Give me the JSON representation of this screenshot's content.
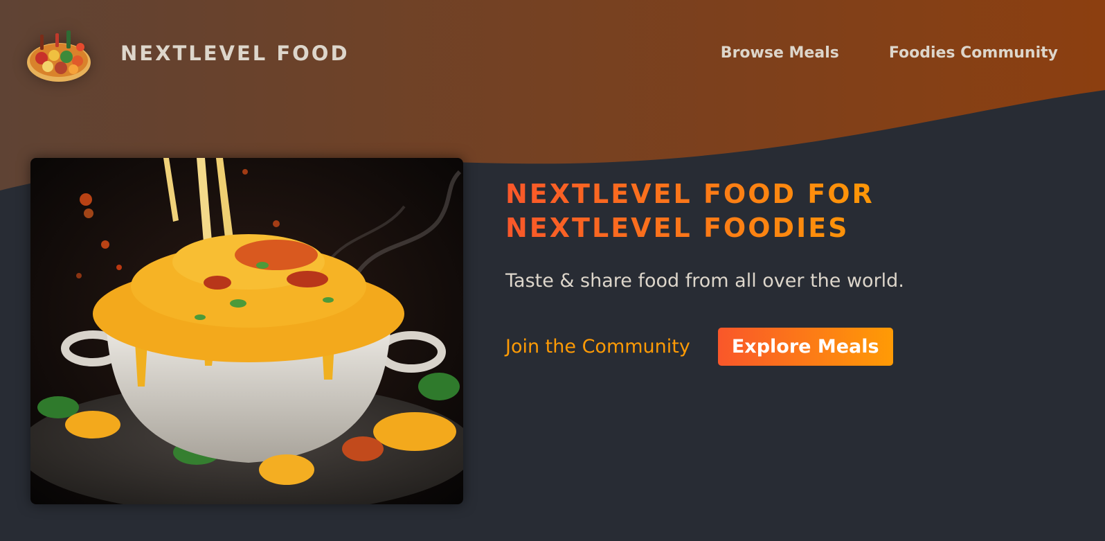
{
  "header": {
    "logo_alt": "A plate with food on it",
    "logo_text": "NEXTLEVEL FOOD",
    "nav": [
      {
        "label": "Browse Meals"
      },
      {
        "label": "Foodies Community"
      }
    ]
  },
  "hero": {
    "title_line_1": "NEXTLEVEL FOOD FOR",
    "title_line_2": "NEXTLEVEL FOODIES",
    "subtitle": "Taste & share food from all over the world.",
    "community_link": "Join the Community",
    "explore_button": "Explore Meals",
    "image_description": "mac and cheese"
  },
  "colors": {
    "header_gradient_start": "#5f4334",
    "header_gradient_end": "#8c3f10",
    "background": "#282c34",
    "accent_start": "#f9572a",
    "accent_end": "#ff9b05",
    "text_light": "#ddd6cb"
  }
}
